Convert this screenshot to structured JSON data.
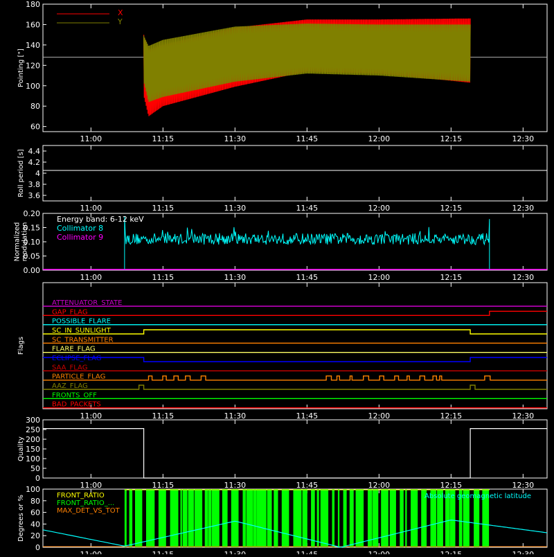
{
  "time_axis": {
    "start": "10:50",
    "end": "12:35",
    "ticks": [
      "11:00",
      "11:15",
      "11:30",
      "11:45",
      "12:00",
      "12:15",
      "12:30"
    ]
  },
  "chart_data": [
    {
      "id": "pointing",
      "type": "line",
      "ylabel": "Pointing [\"]",
      "ylim": [
        55,
        180
      ],
      "yticks": [
        60,
        80,
        100,
        120,
        140,
        160,
        180
      ],
      "reference_line": 128,
      "legend_placement": "top-left",
      "series": [
        {
          "name": "X",
          "color": "#ff0000",
          "x_range": [
            "11:11",
            "12:19"
          ],
          "envelope_upper": [
            [
              "11:11",
              150
            ],
            [
              "11:12",
              135
            ],
            [
              "11:15",
              140
            ],
            [
              "11:30",
              157
            ],
            [
              "11:45",
              165
            ],
            [
              "12:00",
              165
            ],
            [
              "12:19",
              166
            ]
          ],
          "envelope_lower": [
            [
              "11:11",
              90
            ],
            [
              "11:12",
              70
            ],
            [
              "11:15",
              80
            ],
            [
              "11:30",
              99
            ],
            [
              "11:45",
              114
            ],
            [
              "12:00",
              112
            ],
            [
              "12:19",
              103
            ]
          ]
        },
        {
          "name": "Y",
          "color": "#808000",
          "x_range": [
            "11:11",
            "12:19"
          ],
          "envelope_upper": [
            [
              "11:11",
              149
            ],
            [
              "11:12",
              139
            ],
            [
              "11:15",
              145
            ],
            [
              "11:30",
              158
            ],
            [
              "11:45",
              161
            ],
            [
              "12:00",
              160
            ],
            [
              "12:19",
              160
            ]
          ],
          "envelope_lower": [
            [
              "11:11",
              104
            ],
            [
              "11:12",
              84
            ],
            [
              "11:15",
              89
            ],
            [
              "11:30",
              104
            ],
            [
              "11:45",
              112
            ],
            [
              "12:00",
              110
            ],
            [
              "12:19",
              104
            ]
          ]
        }
      ]
    },
    {
      "id": "roll",
      "type": "line",
      "ylabel": "Roll period [s]",
      "ylim": [
        3.5,
        4.5
      ],
      "yticks": [
        3.6,
        3.8,
        4.0,
        4.2,
        4.4
      ],
      "series": [
        {
          "name": "",
          "color": "#ffffff",
          "constant": 4.05
        }
      ]
    },
    {
      "id": "modulation",
      "type": "line",
      "ylabel": "Normalized modulation",
      "ylim": [
        0,
        0.2
      ],
      "yticks": [
        "0.00",
        "0.05",
        "0.10",
        "0.15",
        "0.20"
      ],
      "legend_placement": "top-left",
      "annotation": "Energy band: 6-12 keV",
      "series": [
        {
          "name": "Collimator 8",
          "color": "#00ffff",
          "x_range": [
            "11:07",
            "12:23"
          ],
          "mean": 0.11,
          "spread": 0.04
        },
        {
          "name": "Collimator 9",
          "color": "#ff00ff",
          "constant": 0.0
        }
      ]
    },
    {
      "id": "flags",
      "type": "line",
      "ylabel": "Flags",
      "series": [
        {
          "name": "ATTENUATOR_STATE",
          "color": "#cc00cc",
          "segments": [
            [
              "10:50",
              0
            ]
          ]
        },
        {
          "name": "GAP_FLAG",
          "color": "#ff0000",
          "segments": [
            [
              "10:50",
              0
            ],
            [
              "12:23",
              1
            ]
          ]
        },
        {
          "name": "POSSIBLE_FLARE",
          "color": "#00ffff",
          "segments": [
            [
              "10:50",
              0
            ]
          ]
        },
        {
          "name": "SC_IN_SUNLIGHT",
          "color": "#ffff00",
          "segments": [
            [
              "10:50",
              0
            ],
            [
              "11:11",
              1
            ],
            [
              "12:19",
              0
            ]
          ]
        },
        {
          "name": "SC_TRANSMITTER",
          "color": "#ff8000",
          "segments": [
            [
              "10:50",
              0
            ]
          ]
        },
        {
          "name": "FLARE_FLAG",
          "color": "#ffff66",
          "segments": [
            [
              "10:50",
              0
            ]
          ]
        },
        {
          "name": "ECLIPSE_FLAG",
          "color": "#0000ff",
          "segments": [
            [
              "10:50",
              1
            ],
            [
              "11:11",
              0
            ],
            [
              "12:19",
              1
            ]
          ]
        },
        {
          "name": "SAA_FLAG",
          "color": "#cc0000",
          "segments": [
            [
              "10:50",
              0
            ]
          ]
        },
        {
          "name": "PARTICLE_FLAG",
          "color": "#ff8000",
          "pulses": true
        },
        {
          "name": "AAZ_FLAG",
          "color": "#808000",
          "segments": [
            [
              "10:50",
              0
            ],
            [
              "11:10",
              1
            ],
            [
              "11:11",
              0
            ],
            [
              "12:19",
              1
            ],
            [
              "12:20",
              0
            ]
          ]
        },
        {
          "name": "FRONTS_OFF",
          "color": "#00ff00",
          "segments": [
            [
              "10:50",
              0
            ]
          ]
        },
        {
          "name": "BAD_PACKETS",
          "color": "#ff0000",
          "segments": [
            [
              "10:50",
              0
            ]
          ]
        }
      ]
    },
    {
      "id": "quality",
      "type": "line",
      "ylabel": "Quality",
      "ylim": [
        0,
        300
      ],
      "yticks": [
        0,
        50,
        100,
        150,
        200,
        250,
        300
      ],
      "series": [
        {
          "name": "",
          "color": "#ffffff",
          "points": [
            [
              "10:50",
              255
            ],
            [
              "11:11",
              255
            ],
            [
              "11:11",
              0
            ],
            [
              "12:19",
              0
            ],
            [
              "12:19",
              255
            ],
            [
              "12:35",
              255
            ]
          ]
        }
      ]
    },
    {
      "id": "ratio",
      "type": "line",
      "ylabel": "Degrees or %",
      "ylim": [
        0,
        100
      ],
      "yticks": [
        0,
        20,
        40,
        60,
        80,
        100
      ],
      "annotation": "Absolute geomagnetic latitude",
      "series": [
        {
          "name": "FRONT_RATIO",
          "color": "#ffff00"
        },
        {
          "name": "FRONT_RATIO_...",
          "color": "#00ff00",
          "x_range": [
            "11:07",
            "12:23"
          ]
        },
        {
          "name": "MAX_DET_VS_TOT",
          "color": "#ff8000"
        },
        {
          "name": "Absolute geomagnetic latitude",
          "color": "#00ffff",
          "points": [
            [
              "10:50",
              30
            ],
            [
              "11:07",
              2
            ],
            [
              "11:30",
              45
            ],
            [
              "11:52",
              0
            ],
            [
              "12:15",
              47
            ],
            [
              "12:35",
              25
            ]
          ]
        }
      ]
    }
  ]
}
